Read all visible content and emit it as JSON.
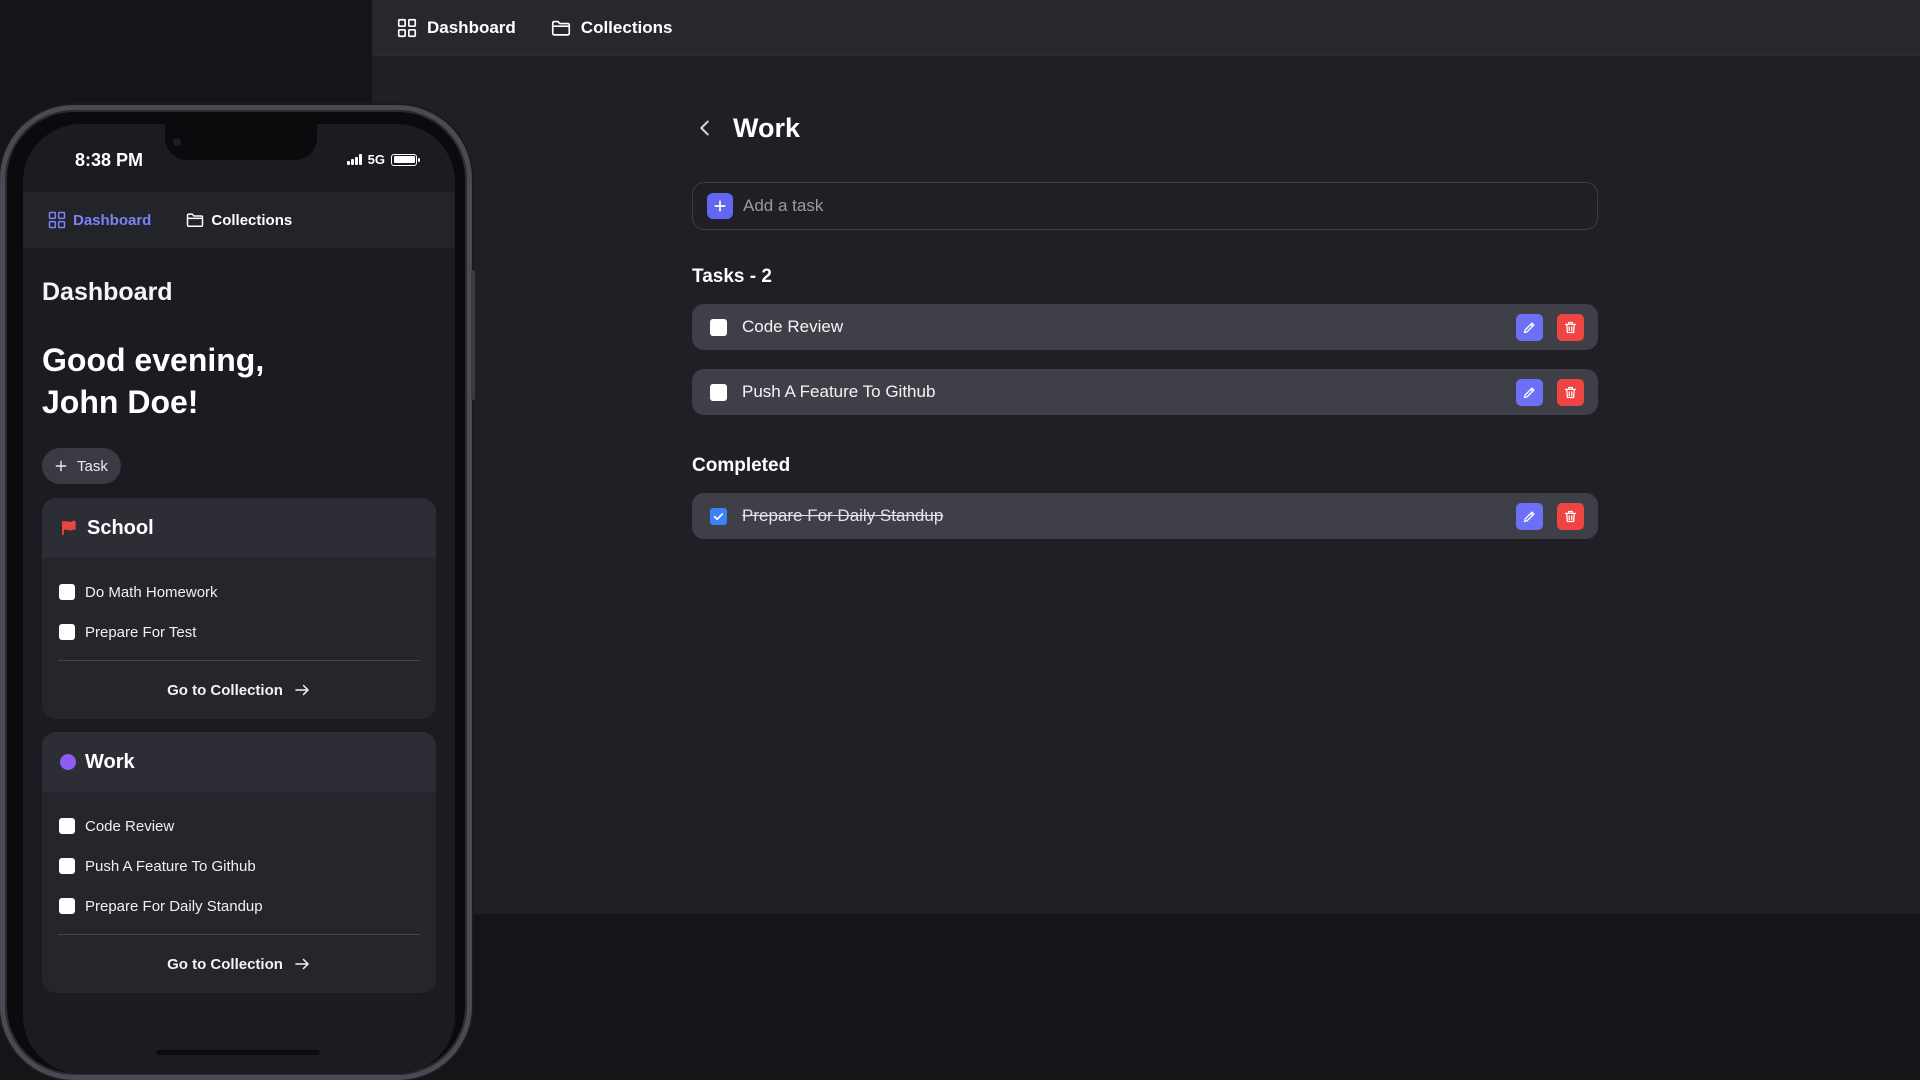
{
  "desktop": {
    "nav": {
      "dashboard_label": "Dashboard",
      "collections_label": "Collections"
    },
    "page_title": "Work",
    "add_task_placeholder": "Add a task",
    "tasks_header": "Tasks - 2",
    "tasks": [
      {
        "label": "Code Review",
        "done": false
      },
      {
        "label": "Push A Feature To Github",
        "done": false
      }
    ],
    "completed_header": "Completed",
    "completed": [
      {
        "label": "Prepare For Daily Standup",
        "done": true
      }
    ]
  },
  "phone": {
    "status": {
      "time": "8:38 PM",
      "network": "5G"
    },
    "nav": {
      "dashboard_label": "Dashboard",
      "collections_label": "Collections"
    },
    "page_title": "Dashboard",
    "greeting_line1": "Good evening,",
    "greeting_line2": "John Doe!",
    "add_task_label": "Task",
    "collections": [
      {
        "name": "School",
        "icon": "flag-icon",
        "color": "#ef4444",
        "items": [
          "Do Math Homework",
          "Prepare For Test"
        ],
        "footer_label": "Go to Collection"
      },
      {
        "name": "Work",
        "icon": "dot-icon",
        "color": "#8b5cf6",
        "items": [
          "Code Review",
          "Push A Feature To Github",
          "Prepare For Daily Standup"
        ],
        "footer_label": "Go to Collection"
      }
    ]
  },
  "colors": {
    "accent": "#6366f1",
    "active_nav": "#7b84f7",
    "danger": "#ef4444",
    "checked": "#3b82f6"
  }
}
